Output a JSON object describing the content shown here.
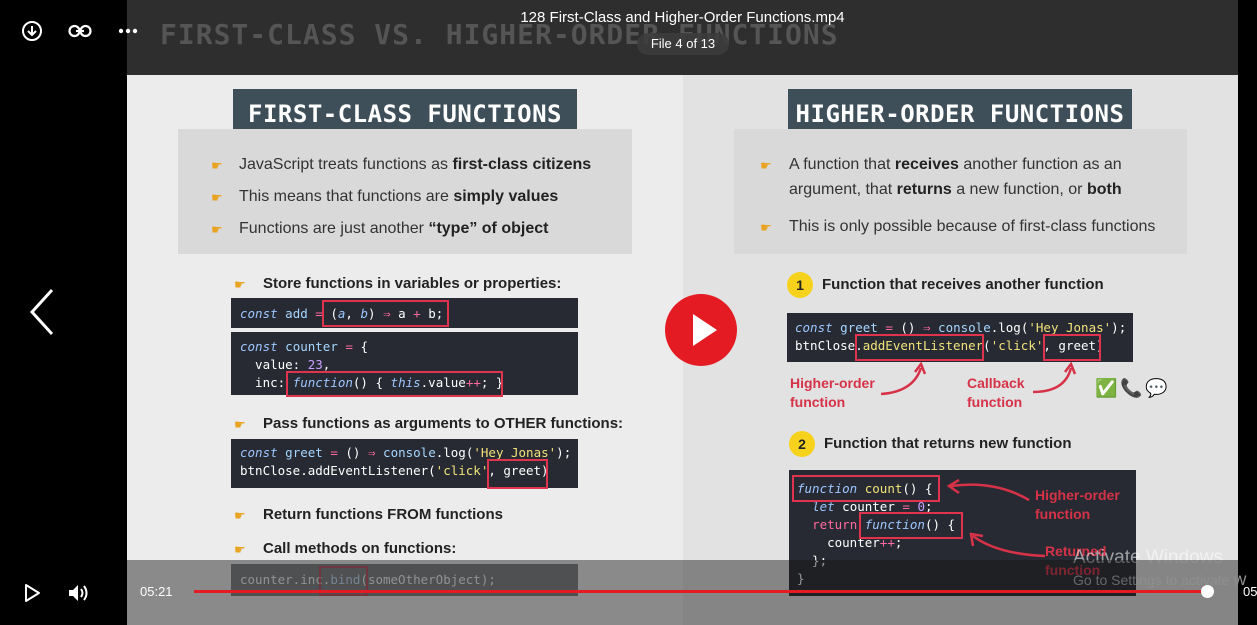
{
  "player": {
    "file_title": "128 First-Class and Higher-Order Functions.mp4",
    "file_counter": "File 4 of 13",
    "current_time": "05:21",
    "end_time_partial": "05",
    "progress": 0.999,
    "icons": {
      "download": "download-icon",
      "link": "link-icon",
      "more": "more-icon",
      "prev": "chevron-left-icon",
      "play": "play-icon",
      "volume": "volume-icon"
    },
    "accent_color": "#e41b23"
  },
  "slide": {
    "title": "FIRST-CLASS VS. HIGHER-ORDER FUNCTIONS",
    "left": {
      "banner": "FIRST-CLASS FUNCTIONS",
      "bullets": [
        {
          "pre": "JavaScript treats functions as ",
          "bold": "first-class citizens",
          "post": ""
        },
        {
          "pre": "This means that functions are ",
          "bold": "simply values",
          "post": ""
        },
        {
          "pre": "Functions are just another ",
          "bold": "“type” of object",
          "post": ""
        }
      ],
      "sub1": "Store functions in variables or properties:",
      "sub2": "Pass functions as arguments to OTHER functions:",
      "sub3": "Return functions FROM functions",
      "sub4": "Call methods on functions:"
    },
    "right": {
      "banner": "HIGHER-ORDER FUNCTIONS",
      "bullet1_line1": {
        "pre": "A function that ",
        "b1": "receives",
        "post": " another function as an"
      },
      "bullet1_line2": {
        "pre": "argument, that ",
        "b1": "returns",
        "mid": " a new function, or ",
        "b2": "both"
      },
      "bullet2": "This is only possible because of first-class functions",
      "n1": "1",
      "n1_label": "Function that receives another function",
      "n2": "2",
      "n2_label": "Function that returns new function",
      "lbl_higher_order_1": [
        "Higher-order",
        "function"
      ],
      "lbl_callback": [
        "Callback",
        "function"
      ],
      "lbl_higher_order_2": [
        "Higher-order",
        "function"
      ],
      "lbl_returned": [
        "Returned",
        "function"
      ]
    }
  },
  "watermark": {
    "line1": "Activate Windows",
    "line2": "Go to Settings to activate W"
  }
}
